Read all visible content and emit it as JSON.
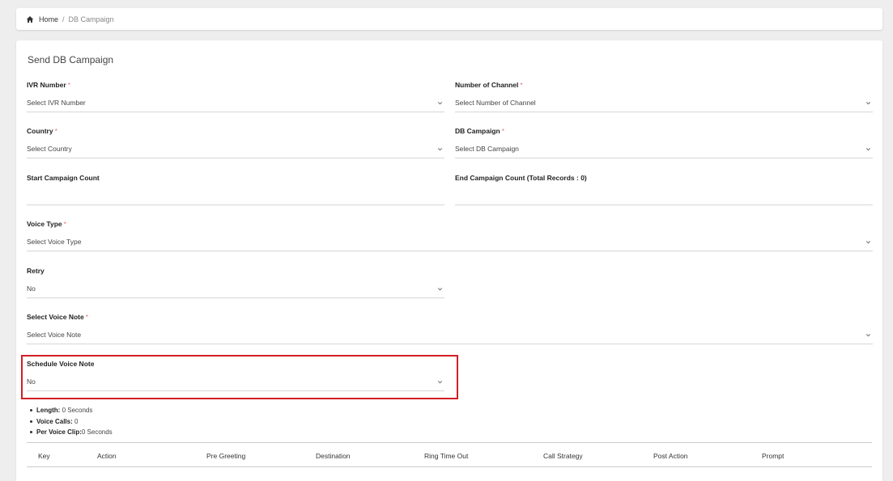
{
  "breadcrumb": {
    "home": "Home",
    "separator": "/",
    "current": "DB Campaign"
  },
  "page": {
    "title": "Send DB Campaign"
  },
  "form": {
    "ivr_number": {
      "label": "IVR Number",
      "required": "*",
      "value": "Select IVR Number"
    },
    "number_of_channel": {
      "label": "Number of Channel",
      "required": "*",
      "value": "Select Number of Channel"
    },
    "country": {
      "label": "Country",
      "required": "*",
      "value": "Select Country"
    },
    "db_campaign": {
      "label": "DB Campaign",
      "required": "*",
      "value": "Select DB Campaign"
    },
    "start_campaign_count": {
      "label": "Start Campaign Count",
      "value": ""
    },
    "end_campaign_count": {
      "label": "End Campaign Count (Total Records : 0)",
      "value": ""
    },
    "voice_type": {
      "label": "Voice Type",
      "required": "*",
      "value": "Select Voice Type"
    },
    "retry": {
      "label": "Retry",
      "value": "No"
    },
    "select_voice_note": {
      "label": "Select Voice Note",
      "required": "*",
      "value": "Select Voice Note"
    },
    "schedule_voice_note": {
      "label": "Schedule Voice Note",
      "value": "No"
    }
  },
  "info": {
    "length": {
      "label": "Length:",
      "value": "0 Seconds"
    },
    "voice_calls": {
      "label": "Voice Calls:",
      "value": "0"
    },
    "per_voice_clip": {
      "label": "Per Voice Clip:",
      "value": "0 Seconds"
    }
  },
  "table": {
    "columns": [
      "Key",
      "Action",
      "Pre Greeting",
      "Destination",
      "Ring Time Out",
      "Call Strategy",
      "Post Action",
      "Prompt"
    ]
  },
  "colors": {
    "highlight": "#d31e25",
    "required": "#e57373"
  }
}
